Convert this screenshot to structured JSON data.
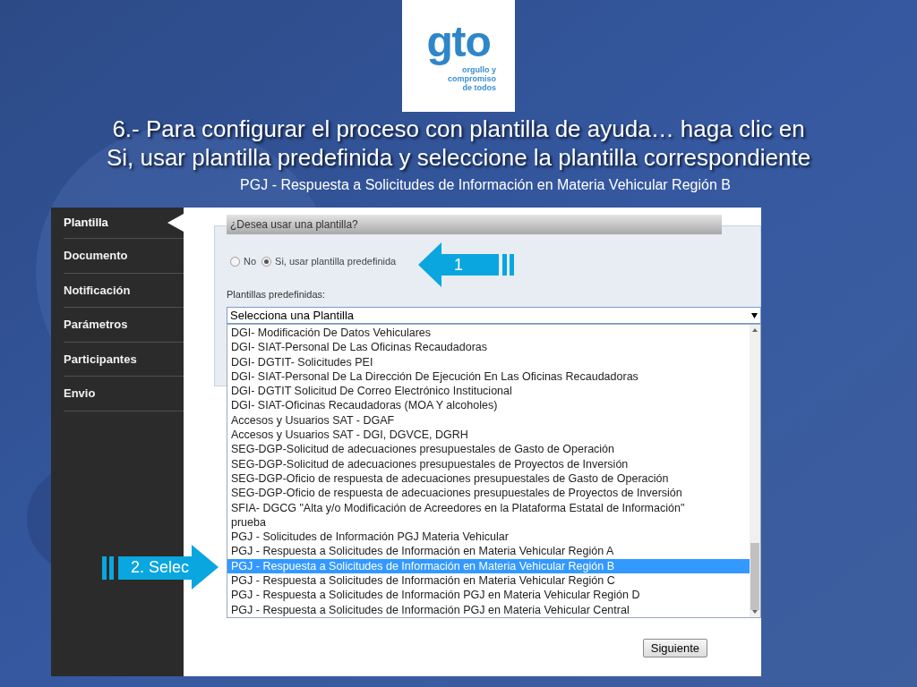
{
  "logo": {
    "text": "gto",
    "tagline": [
      "orgullo y",
      "compromiso",
      "de todos"
    ]
  },
  "title": [
    "6.- Para configurar el proceso con plantilla de ayuda… haga clic en",
    "Si, usar plantilla predefinida y seleccione la plantilla correspondiente"
  ],
  "subtitle": "PGJ - Respuesta a Solicitudes de Información en Materia Vehicular Región B",
  "sidebar": {
    "items": [
      {
        "label": "Plantilla",
        "selected": true
      },
      {
        "label": "Documento",
        "selected": false
      },
      {
        "label": "Notificación",
        "selected": false
      },
      {
        "label": "Parámetros",
        "selected": false
      },
      {
        "label": "Participantes",
        "selected": false
      },
      {
        "label": "Envio",
        "selected": false
      }
    ]
  },
  "panel": {
    "heading": "¿Desea usar una plantilla?",
    "radios": [
      {
        "label": "No",
        "selected": false
      },
      {
        "label": "Si, usar plantilla predefinida",
        "selected": true
      }
    ],
    "select_label": "Plantillas predefinidas:",
    "select_value": "Selecciona una Plantilla",
    "options": [
      {
        "label": "DGI- Modificación De Datos Vehiculares",
        "selected": false
      },
      {
        "label": "DGI- SIAT-Personal De Las Oficinas Recaudadoras",
        "selected": false
      },
      {
        "label": "DGI- DGTIT- Solicitudes PEI",
        "selected": false
      },
      {
        "label": "DGI- SIAT-Personal De La Dirección De Ejecución En Las Oficinas Recaudadoras",
        "selected": false
      },
      {
        "label": "DGI- DGTIT Solicitud De Correo Electrónico Institucional",
        "selected": false
      },
      {
        "label": "DGI- SIAT-Oficinas Recaudadoras (MOA Y alcoholes)",
        "selected": false
      },
      {
        "label": "Accesos y Usuarios SAT - DGAF",
        "selected": false
      },
      {
        "label": "Accesos y Usuarios SAT - DGI, DGVCE, DGRH",
        "selected": false
      },
      {
        "label": "SEG-DGP-Solicitud de adecuaciones presupuestales de Gasto de Operación",
        "selected": false
      },
      {
        "label": "SEG-DGP-Solicitud de adecuaciones presupuestales de Proyectos de Inversión",
        "selected": false
      },
      {
        "label": "SEG-DGP-Oficio de respuesta de adecuaciones presupuestales de Gasto de Operación",
        "selected": false
      },
      {
        "label": "SEG-DGP-Oficio de respuesta de adecuaciones presupuestales de Proyectos de Inversión",
        "selected": false
      },
      {
        "label": "SFIA- DGCG \"Alta y/o Modificación de Acreedores en la Plataforma Estatal de Información\"",
        "selected": false
      },
      {
        "label": "prueba",
        "selected": false
      },
      {
        "label": "PGJ - Solicitudes de Información PGJ Materia Vehicular",
        "selected": false
      },
      {
        "label": "PGJ - Respuesta a Solicitudes de Información en Materia Vehicular Región A",
        "selected": false
      },
      {
        "label": "PGJ - Respuesta a Solicitudes de Información en Materia Vehicular Región B",
        "selected": true
      },
      {
        "label": "PGJ - Respuesta a Solicitudes de Información en Materia Vehicular Región C",
        "selected": false
      },
      {
        "label": "PGJ - Respuesta a Solicitudes de Información PGJ en Materia Vehicular Región D",
        "selected": false
      },
      {
        "label": "PGJ - Respuesta a Solicitudes de Información PGJ en Materia Vehicular Central",
        "selected": false
      }
    ]
  },
  "button": "Siguiente",
  "callouts": [
    {
      "kind": "left",
      "text": "1"
    },
    {
      "kind": "right",
      "text": "2. Selec"
    }
  ]
}
